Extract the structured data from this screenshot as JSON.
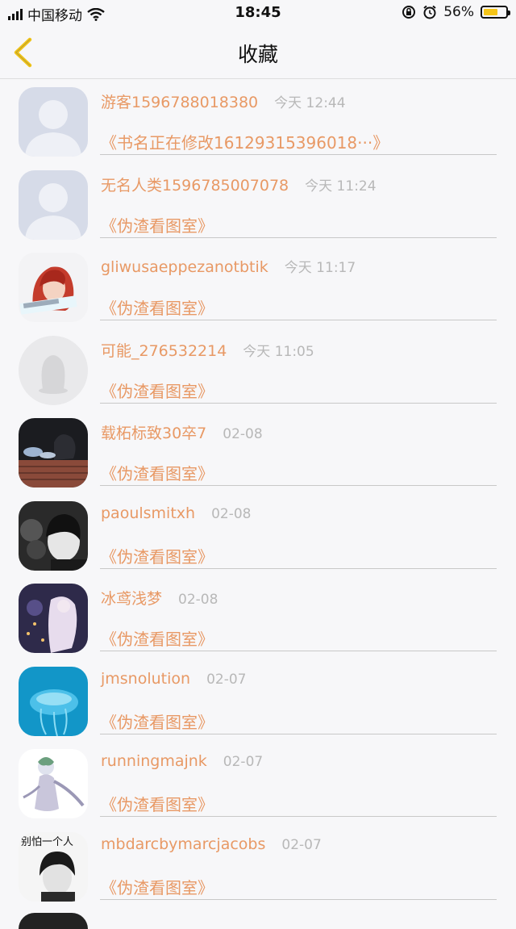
{
  "status_bar": {
    "carrier": "中国移动",
    "time": "18:45",
    "battery_percent": "56%",
    "battery_level": 0.56,
    "battery_color": "#f5c518",
    "icons": [
      "signal-icon",
      "wifi-icon",
      "orientation-lock-icon",
      "alarm-icon",
      "battery-icon"
    ]
  },
  "nav": {
    "title": "收藏",
    "back_icon": "chevron-left-icon",
    "accent_color": "#f0c419"
  },
  "items": [
    {
      "name": "游客1596788018380",
      "time": "今天 12:44",
      "book": "《书名正在修改16129315396018···》",
      "avatar": "default-person"
    },
    {
      "name": "无名人类1596785007078",
      "time": "今天 11:24",
      "book": "《伪渣看图室》",
      "avatar": "default-person"
    },
    {
      "name": "gliwusaeppezanotbtik",
      "time": "今天 11:17",
      "book": "《伪渣看图室》",
      "avatar": "red-hair-photo"
    },
    {
      "name": "可能_276532214",
      "time": "今天 11:05",
      "book": "《伪渣看图室》",
      "avatar": "default-penguin"
    },
    {
      "name": "载柘标致30卒7",
      "time": "02-08",
      "book": "《伪渣看图室》",
      "avatar": "wall-photo"
    },
    {
      "name": "paoulsmitxh",
      "time": "02-08",
      "book": "《伪渣看图室》",
      "avatar": "bw-portrait"
    },
    {
      "name": "冰鸢浅梦",
      "time": "02-08",
      "book": "《伪渣看图室》",
      "avatar": "anime-photo"
    },
    {
      "name": "jmsnolution",
      "time": "02-07",
      "book": "《伪渣看图室》",
      "avatar": "jellyfish-photo"
    },
    {
      "name": "runningmajnk",
      "time": "02-07",
      "book": "《伪渣看图室》",
      "avatar": "pokemon-drawing"
    },
    {
      "name": "mbdarcbymarcjacobs",
      "time": "02-07",
      "book": "《伪渣看图室》",
      "avatar": "text-portrait",
      "avatar_text": "别怕一个人"
    }
  ]
}
